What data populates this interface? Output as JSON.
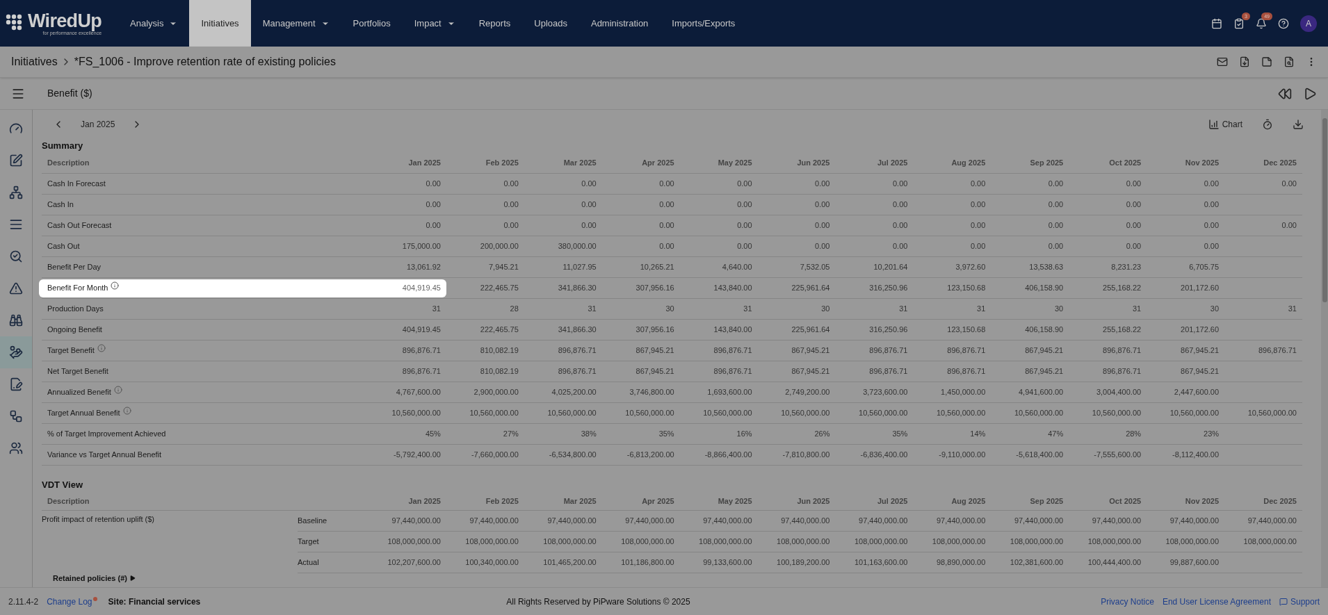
{
  "logo": {
    "name": "WiredUp",
    "tagline": "for performance excellence"
  },
  "nav": [
    {
      "label": "Analysis",
      "dropdown": true,
      "selected": false
    },
    {
      "label": "Initiatives",
      "dropdown": false,
      "selected": true
    },
    {
      "label": "Management",
      "dropdown": true,
      "selected": false
    },
    {
      "label": "Portfolios",
      "dropdown": false,
      "selected": false
    },
    {
      "label": "Impact",
      "dropdown": true,
      "selected": false
    },
    {
      "label": "Reports",
      "dropdown": false,
      "selected": false
    },
    {
      "label": "Uploads",
      "dropdown": false,
      "selected": false
    },
    {
      "label": "Administration",
      "dropdown": false,
      "selected": false
    },
    {
      "label": "Imports/Exports",
      "dropdown": false,
      "selected": false
    }
  ],
  "header_icons": [
    {
      "kind": "calendar"
    },
    {
      "kind": "tasks",
      "badge": "3"
    },
    {
      "kind": "bell",
      "badge": "49"
    },
    {
      "kind": "help"
    }
  ],
  "avatar": "A",
  "breadcrumb": {
    "root": "Initiatives",
    "current": "*FS_1006 - Improve retention rate of existing policies"
  },
  "page_title": "Benefit ($)",
  "sidebar": [
    {
      "kind": "gauge",
      "selected": false
    },
    {
      "kind": "edit",
      "selected": false
    },
    {
      "kind": "tree",
      "selected": false
    },
    {
      "kind": "list",
      "selected": false
    },
    {
      "kind": "search",
      "selected": false
    },
    {
      "kind": "alert",
      "selected": false
    },
    {
      "kind": "binoculars",
      "selected": false
    },
    {
      "kind": "benefit",
      "selected": true
    },
    {
      "kind": "sign",
      "selected": false
    },
    {
      "kind": "workflow",
      "selected": false
    },
    {
      "kind": "users",
      "selected": false
    }
  ],
  "period": "Jan 2025",
  "chart_button": "Chart",
  "months": [
    "Jan 2025",
    "Feb 2025",
    "Mar 2025",
    "Apr 2025",
    "May 2025",
    "Jun 2025",
    "Jul 2025",
    "Aug 2025",
    "Sep 2025",
    "Oct 2025",
    "Nov 2025",
    "Dec 2025"
  ],
  "summary": {
    "title": "Summary",
    "description_header": "Description",
    "rows": [
      {
        "label": "Cash In Forecast",
        "info": false,
        "highlighted": false,
        "values": [
          "0.00",
          "0.00",
          "0.00",
          "0.00",
          "0.00",
          "0.00",
          "0.00",
          "0.00",
          "0.00",
          "0.00",
          "0.00",
          "0.00"
        ]
      },
      {
        "label": "Cash In",
        "info": false,
        "highlighted": false,
        "values": [
          "0.00",
          "0.00",
          "0.00",
          "0.00",
          "0.00",
          "0.00",
          "0.00",
          "0.00",
          "0.00",
          "0.00",
          "0.00"
        ]
      },
      {
        "label": "Cash Out Forecast",
        "info": false,
        "highlighted": false,
        "values": [
          "0.00",
          "0.00",
          "0.00",
          "0.00",
          "0.00",
          "0.00",
          "0.00",
          "0.00",
          "0.00",
          "0.00",
          "0.00",
          "0.00"
        ]
      },
      {
        "label": "Cash Out",
        "info": false,
        "highlighted": false,
        "values": [
          "175,000.00",
          "200,000.00",
          "380,000.00",
          "0.00",
          "0.00",
          "0.00",
          "0.00",
          "0.00",
          "0.00",
          "0.00",
          "0.00"
        ]
      },
      {
        "label": "Benefit Per Day",
        "info": false,
        "highlighted": false,
        "values": [
          "13,061.92",
          "7,945.21",
          "11,027.95",
          "10,265.21",
          "4,640.00",
          "7,532.05",
          "10,201.64",
          "3,972.60",
          "13,538.63",
          "8,231.23",
          "6,705.75"
        ]
      },
      {
        "label": "Benefit For Month",
        "info": true,
        "highlighted": true,
        "values": [
          "404,919.45",
          "222,465.75",
          "341,866.30",
          "307,956.16",
          "143,840.00",
          "225,961.64",
          "316,250.96",
          "123,150.68",
          "406,158.90",
          "255,168.22",
          "201,172.60"
        ]
      },
      {
        "label": "Production Days",
        "info": false,
        "highlighted": false,
        "values": [
          "31",
          "28",
          "31",
          "30",
          "31",
          "30",
          "31",
          "31",
          "30",
          "31",
          "30",
          "31"
        ]
      },
      {
        "label": "Ongoing Benefit",
        "info": false,
        "highlighted": false,
        "values": [
          "404,919.45",
          "222,465.75",
          "341,866.30",
          "307,956.16",
          "143,840.00",
          "225,961.64",
          "316,250.96",
          "123,150.68",
          "406,158.90",
          "255,168.22",
          "201,172.60"
        ]
      },
      {
        "label": "Target Benefit",
        "info": true,
        "highlighted": false,
        "values": [
          "896,876.71",
          "810,082.19",
          "896,876.71",
          "867,945.21",
          "896,876.71",
          "867,945.21",
          "896,876.71",
          "896,876.71",
          "867,945.21",
          "896,876.71",
          "867,945.21",
          "896,876.71"
        ]
      },
      {
        "label": "Net Target Benefit",
        "info": false,
        "highlighted": false,
        "values": [
          "896,876.71",
          "810,082.19",
          "896,876.71",
          "867,945.21",
          "896,876.71",
          "867,945.21",
          "896,876.71",
          "896,876.71",
          "867,945.21",
          "896,876.71",
          "867,945.21"
        ]
      },
      {
        "label": "Annualized Benefit",
        "info": true,
        "highlighted": false,
        "values": [
          "4,767,600.00",
          "2,900,000.00",
          "4,025,200.00",
          "3,746,800.00",
          "1,693,600.00",
          "2,749,200.00",
          "3,723,600.00",
          "1,450,000.00",
          "4,941,600.00",
          "3,004,400.00",
          "2,447,600.00"
        ]
      },
      {
        "label": "Target Annual Benefit",
        "info": true,
        "highlighted": false,
        "values": [
          "10,560,000.00",
          "10,560,000.00",
          "10,560,000.00",
          "10,560,000.00",
          "10,560,000.00",
          "10,560,000.00",
          "10,560,000.00",
          "10,560,000.00",
          "10,560,000.00",
          "10,560,000.00",
          "10,560,000.00",
          "10,560,000.00"
        ]
      },
      {
        "label": "% of Target Improvement Achieved",
        "info": false,
        "highlighted": false,
        "values": [
          "45%",
          "27%",
          "38%",
          "35%",
          "16%",
          "26%",
          "35%",
          "14%",
          "47%",
          "28%",
          "23%"
        ]
      },
      {
        "label": "Variance vs Target Annual Benefit",
        "info": false,
        "highlighted": false,
        "values": [
          "-5,792,400.00",
          "-7,660,000.00",
          "-6,534,800.00",
          "-6,813,200.00",
          "-8,866,400.00",
          "-7,810,800.00",
          "-6,836,400.00",
          "-9,110,000.00",
          "-5,618,400.00",
          "-7,555,600.00",
          "-8,112,400.00"
        ]
      }
    ]
  },
  "vdt": {
    "title": "VDT View",
    "description_header": "Description",
    "months": [
      "Jan 2025",
      "Feb 2025",
      "Mar 2025",
      "Apr 2025",
      "May 2025",
      "Jun 2025",
      "Jul 2025",
      "Aug 2025",
      "Sep 2025",
      "Oct 2025",
      "Nov 2025",
      "Dec 2025"
    ],
    "groups": [
      {
        "label": "Profit impact of retention uplift ($)",
        "rows": [
          {
            "label": "Baseline",
            "values": [
              "97,440,000.00",
              "97,440,000.00",
              "97,440,000.00",
              "97,440,000.00",
              "97,440,000.00",
              "97,440,000.00",
              "97,440,000.00",
              "97,440,000.00",
              "97,440,000.00",
              "97,440,000.00",
              "97,440,000.00",
              "97,440,000.00"
            ]
          },
          {
            "label": "Target",
            "values": [
              "108,000,000.00",
              "108,000,000.00",
              "108,000,000.00",
              "108,000,000.00",
              "108,000,000.00",
              "108,000,000.00",
              "108,000,000.00",
              "108,000,000.00",
              "108,000,000.00",
              "108,000,000.00",
              "108,000,000.00",
              "108,000,000.00"
            ]
          },
          {
            "label": "Actual",
            "values": [
              "102,207,600.00",
              "100,340,000.00",
              "101,465,200.00",
              "101,186,800.00",
              "99,133,600.00",
              "100,189,200.00",
              "101,163,600.00",
              "98,890,000.00",
              "102,381,600.00",
              "100,444,400.00",
              "99,887,600.00"
            ]
          }
        ]
      }
    ],
    "next_group": "Retained policies (#)"
  },
  "footer": {
    "version": "2.11.4-2",
    "change_log": "Change Log",
    "change_log_dot": true,
    "site": "Site: Financial services",
    "copyright": "All Rights Reserved by PiPware Solutions © 2025",
    "links": [
      "Privacy Notice",
      "End User License Agreement"
    ],
    "support": "Support"
  }
}
